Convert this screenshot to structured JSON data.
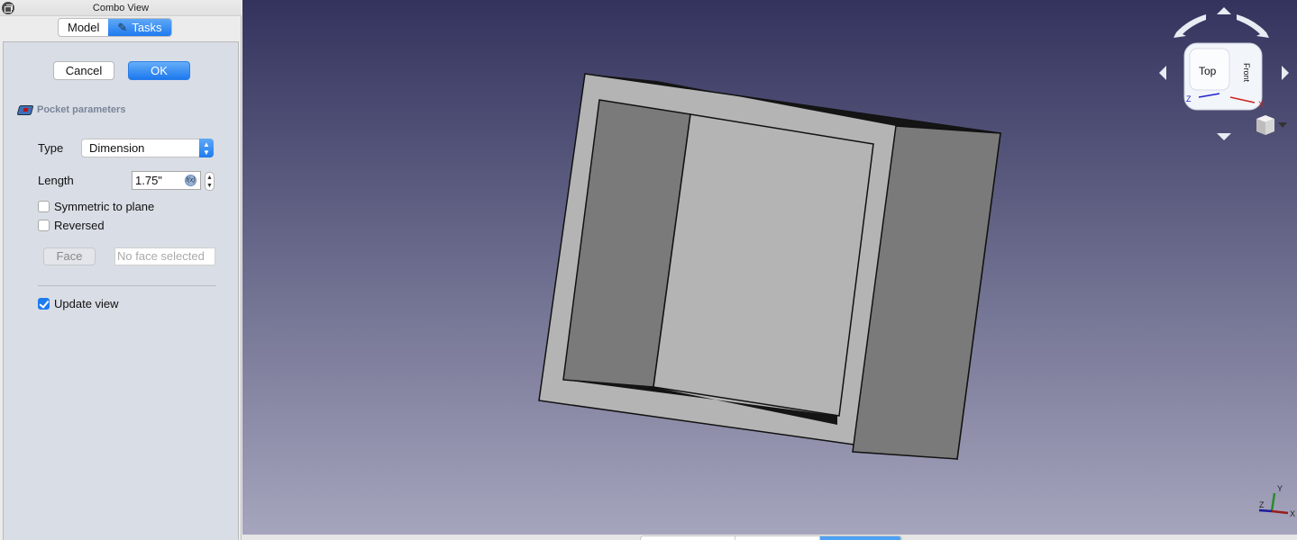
{
  "combo_view": {
    "title": "Combo View",
    "undock_icon": "undock-icon",
    "tabs": [
      {
        "label": "Model",
        "active": false
      },
      {
        "label": "Tasks",
        "active": true,
        "icon": "pencil-icon"
      }
    ]
  },
  "task_panel": {
    "cancel_label": "Cancel",
    "ok_label": "OK",
    "section_title": "Pocket parameters",
    "section_icon": "pocket-icon",
    "type_label": "Type",
    "type_value": "Dimension",
    "length_label": "Length",
    "length_value": "1.75\"",
    "length_expr_icon": "f(x)",
    "symmetric_label": "Symmetric to plane",
    "symmetric_checked": false,
    "reversed_label": "Reversed",
    "reversed_checked": false,
    "face_button_label": "Face",
    "face_placeholder": "No face selected",
    "update_view_label": "Update view",
    "update_view_checked": true
  },
  "viewport": {
    "bg_top": "#33335e",
    "bg_bottom": "#a5a5bd",
    "navcube": {
      "faces": [
        "Top",
        "Front"
      ],
      "axis_labels": [
        "Z",
        "X"
      ]
    },
    "axis_indicator": {
      "x": "X",
      "y": "Y",
      "z": "Z"
    },
    "model_colors": {
      "light": "#b4b4b4",
      "dark": "#7a7a7a",
      "edge": "#111111"
    }
  },
  "view_tabs": [
    {
      "label": "",
      "active": false
    },
    {
      "label": "",
      "active": false
    },
    {
      "label": "",
      "active": true
    }
  ]
}
